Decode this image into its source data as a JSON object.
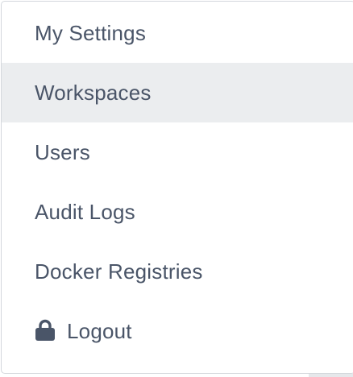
{
  "menu": {
    "items": [
      {
        "label": "My Settings",
        "active": false
      },
      {
        "label": "Workspaces",
        "active": true
      },
      {
        "label": "Users",
        "active": false
      },
      {
        "label": "Audit Logs",
        "active": false
      },
      {
        "label": "Docker Registries",
        "active": false
      },
      {
        "label": "Logout",
        "icon": "lock-icon",
        "active": false
      }
    ]
  },
  "colors": {
    "text": "#4a5568",
    "active_background": "#ebedef",
    "border": "#d3d7dc",
    "icon": "#4a5568"
  }
}
